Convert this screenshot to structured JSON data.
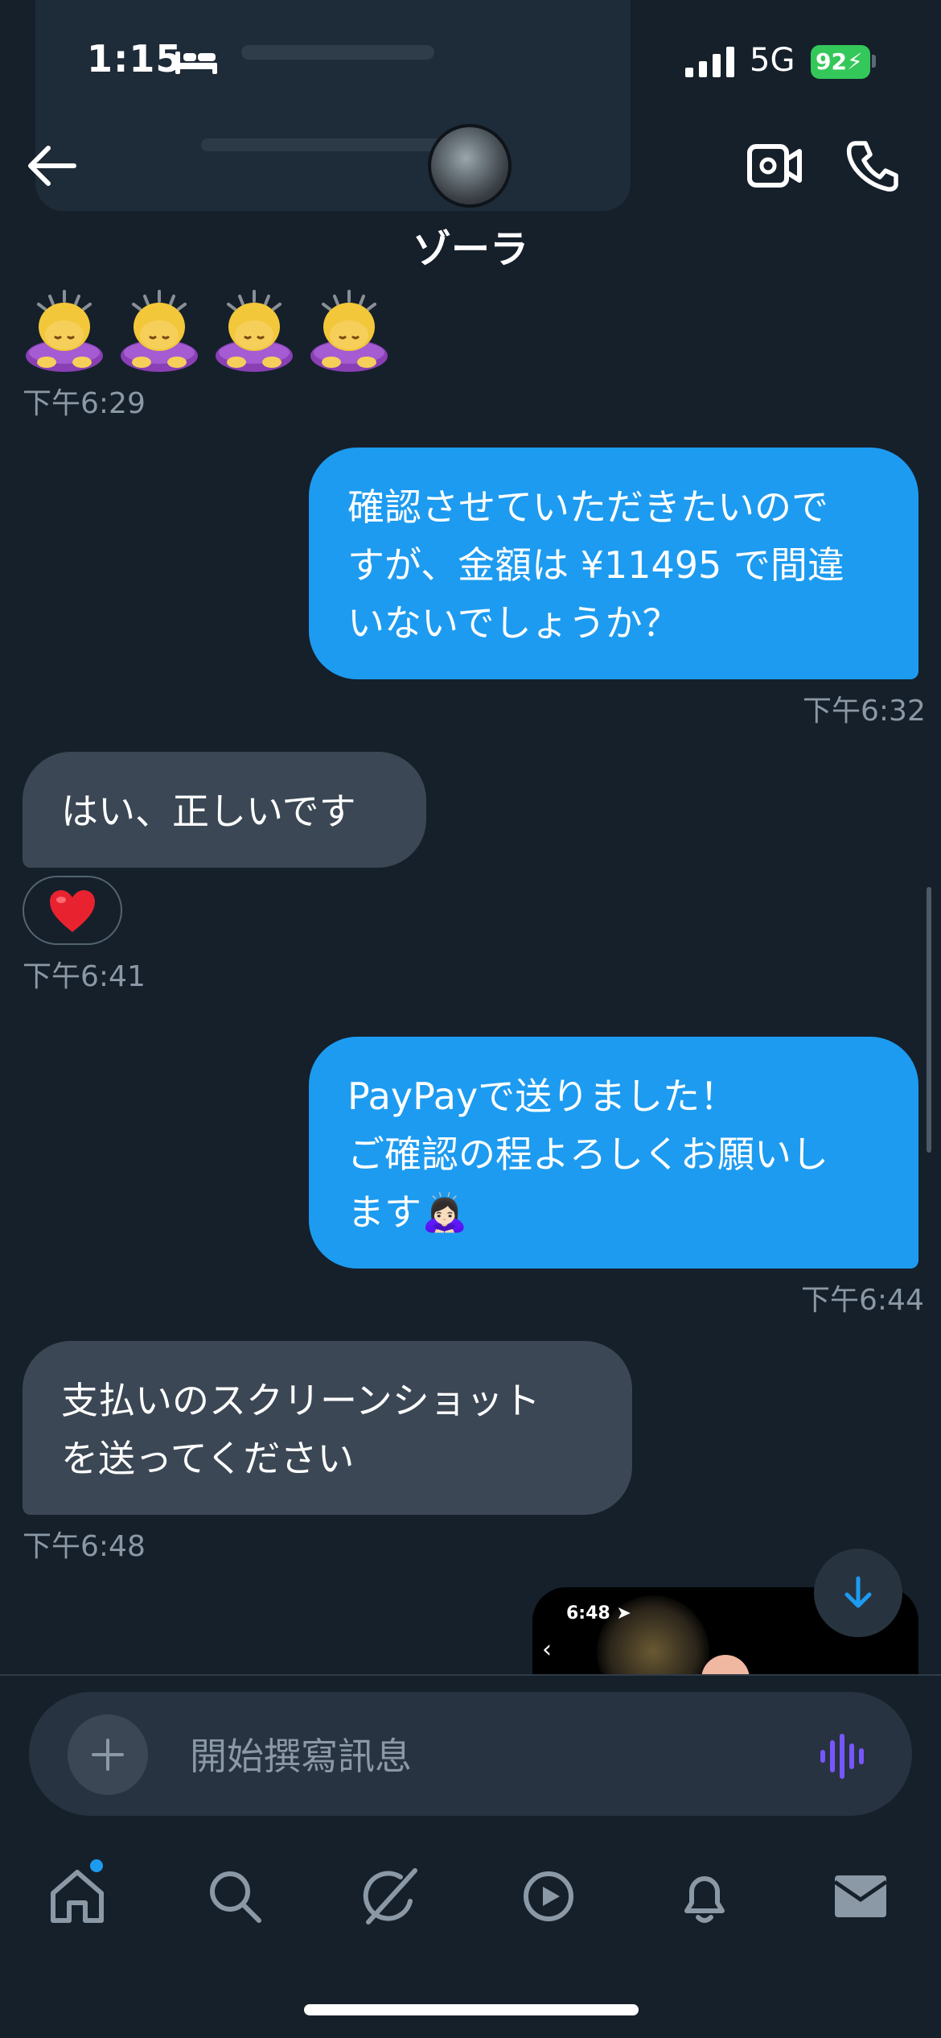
{
  "status_bar": {
    "time": "1:15",
    "network": "5G",
    "battery": "92"
  },
  "header": {
    "contact_name": "ゾーラ"
  },
  "messages": [
    {
      "emoji": "🙇‍♀️🙇‍♀️🙇‍♀️🙇‍♀️",
      "time": "下午6:29"
    },
    {
      "text_lines": [
        "確認させていただきたいので",
        "すが、金額は ¥11495 で間違",
        "いないでしょうか？"
      ],
      "time": "下午6:32"
    },
    {
      "text_lines": [
        "はい、正しいです"
      ],
      "reaction": "❤️",
      "time": "下午6:41"
    },
    {
      "text_lines": [
        "PayPayで送りました！",
        "ご確認の程よろしくお願いし",
        "ます🙇🏻‍♀️"
      ],
      "time": "下午6:44"
    },
    {
      "text_lines": [
        "支払いのスクリーンショット",
        "を送ってください"
      ],
      "time": "下午6:48"
    },
    {
      "image_preview": {
        "time": "6:48"
      }
    }
  ],
  "composer": {
    "placeholder": "開始撰寫訊息"
  },
  "tabs": [
    {
      "icon": "home-icon"
    },
    {
      "icon": "search-icon"
    },
    {
      "icon": "grok-icon"
    },
    {
      "icon": "play-icon"
    },
    {
      "icon": "bell-icon"
    },
    {
      "icon": "mail-icon"
    }
  ],
  "colors": {
    "background": "#15202b",
    "outgoing_bubble": "#1d9bf0",
    "incoming_bubble": "#3b4754",
    "timestamp": "#8b98a5",
    "battery": "#34c759",
    "voice_accent": "#7856ff"
  }
}
